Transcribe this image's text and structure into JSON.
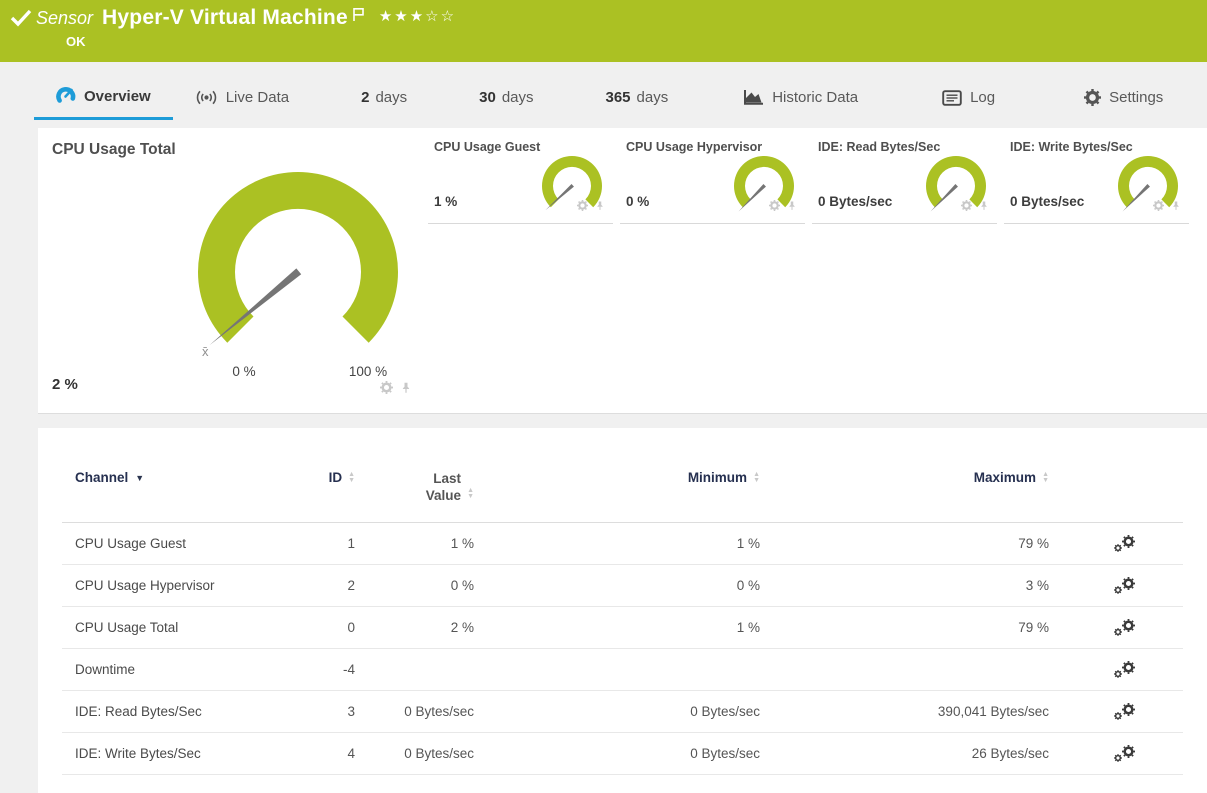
{
  "header": {
    "kind_label": "Sensor",
    "title": "Hyper-V Virtual Machine",
    "status": "OK",
    "rating": {
      "filled": 3,
      "total": 5
    },
    "colors": {
      "bg": "#abc123",
      "text": "#ffffff"
    }
  },
  "tabs": [
    {
      "label": "Overview",
      "icon": "gauge-icon",
      "active": true
    },
    {
      "label": "Live Data",
      "icon": "live-icon",
      "active": false
    },
    {
      "number": "2",
      "label": "days",
      "active": false
    },
    {
      "number": "30",
      "label": "days",
      "active": false
    },
    {
      "number": "365",
      "label": "days",
      "active": false
    },
    {
      "label": "Historic Data",
      "icon": "area-chart-icon",
      "active": false
    },
    {
      "label": "Log",
      "icon": "log-icon",
      "active": false
    },
    {
      "label": "Settings",
      "icon": "gear-icon",
      "active": false
    }
  ],
  "gauges": {
    "accent_color": "#abc123",
    "main": {
      "title": "CPU Usage Total",
      "value": "2 %",
      "percent": 2,
      "scale_min": "0 %",
      "scale_max": "100 %",
      "avg_marker": "x̄"
    },
    "small": [
      {
        "title": "CPU Usage Guest",
        "value": "1 %",
        "percent": 1
      },
      {
        "title": "CPU Usage Hypervisor",
        "value": "0 %",
        "percent": 0
      },
      {
        "title": "IDE: Read Bytes/Sec",
        "value": "0 Bytes/sec",
        "percent": 0
      },
      {
        "title": "IDE: Write Bytes/Sec",
        "value": "0 Bytes/sec",
        "percent": 0
      }
    ]
  },
  "table": {
    "header": {
      "channel": "Channel",
      "id": "ID",
      "last_value": "Last Value",
      "minimum": "Minimum",
      "maximum": "Maximum"
    },
    "rows": [
      {
        "channel": "CPU Usage Guest",
        "id": "1",
        "last": "1 %",
        "min": "1 %",
        "max": "79 %"
      },
      {
        "channel": "CPU Usage Hypervisor",
        "id": "2",
        "last": "0 %",
        "min": "0 %",
        "max": "3 %"
      },
      {
        "channel": "CPU Usage Total",
        "id": "0",
        "last": "2 %",
        "min": "1 %",
        "max": "79 %"
      },
      {
        "channel": "Downtime",
        "id": "-4",
        "last": "",
        "min": "",
        "max": ""
      },
      {
        "channel": "IDE: Read Bytes/Sec",
        "id": "3",
        "last": "0 Bytes/sec",
        "min": "0 Bytes/sec",
        "max": "390,041 Bytes/sec"
      },
      {
        "channel": "IDE: Write Bytes/Sec",
        "id": "4",
        "last": "0 Bytes/sec",
        "min": "0 Bytes/sec",
        "max": "26 Bytes/sec"
      }
    ]
  }
}
